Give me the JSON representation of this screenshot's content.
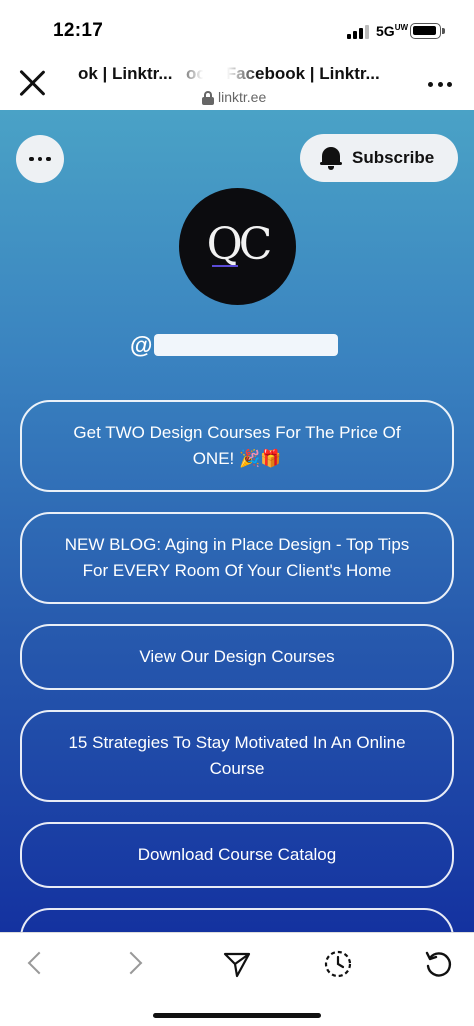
{
  "status_bar": {
    "time": "12:17",
    "network": "5G",
    "network_suffix": "UW"
  },
  "browser": {
    "title_part1": "ok | Linktr...",
    "title_part2": "ool | Facebook | Linktr...",
    "url": "linktr.ee"
  },
  "profile": {
    "subscribe_label": "Subscribe",
    "avatar_text": "QC",
    "handle_prefix": "@"
  },
  "links": [
    {
      "label": "Get TWO Design Courses For The Price Of ONE! 🎉🎁"
    },
    {
      "label": "NEW BLOG: Aging in Place Design - Top Tips For EVERY Room Of Your Client's Home"
    },
    {
      "label": "View Our Design Courses"
    },
    {
      "label": "15 Strategies To Stay Motivated In An Online Course"
    },
    {
      "label": "Download Course Catalog"
    },
    {
      "label": ""
    }
  ],
  "toolbar": {
    "icons": [
      "back-icon",
      "forward-icon",
      "share-icon",
      "history-icon",
      "refresh-icon"
    ]
  }
}
